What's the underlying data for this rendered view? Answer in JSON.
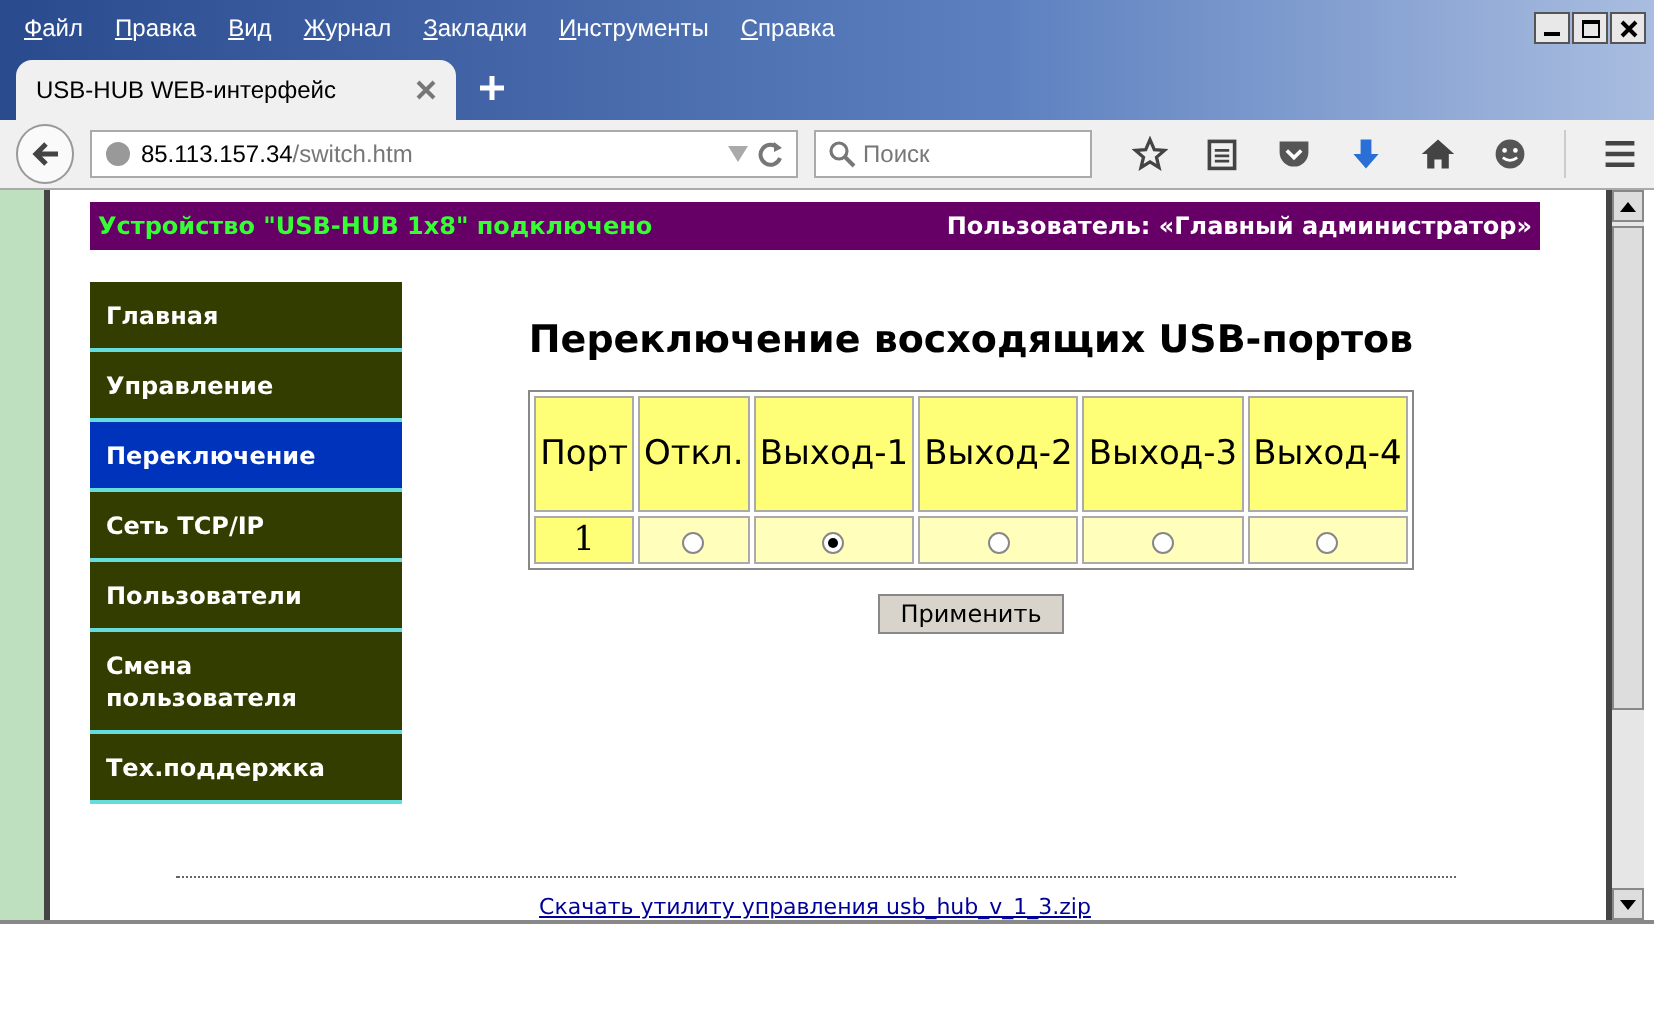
{
  "menu": [
    "Файл",
    "Правка",
    "Вид",
    "Журнал",
    "Закладки",
    "Инструменты",
    "Справка"
  ],
  "tabs": [
    {
      "label": "USB-HUB WEB-интерфейс",
      "selected": true
    }
  ],
  "address": {
    "host": "85.113.157.34",
    "path": "/switch.htm"
  },
  "search": {
    "placeholder": "Поиск"
  },
  "header": {
    "device": "Устройство \"USB-HUB 1x8\" подключено",
    "user": "Пользователь: «Главный администратор»"
  },
  "sidebar": {
    "items": [
      {
        "label": "Главная",
        "selected": false
      },
      {
        "label": "Управление",
        "selected": false
      },
      {
        "label": "Переключение",
        "selected": true
      },
      {
        "label": "Сеть TCP/IP",
        "selected": false
      },
      {
        "label": "Пользователи",
        "selected": false
      },
      {
        "label": "Смена пользователя",
        "selected": false
      },
      {
        "label": "Тех.поддержка",
        "selected": false
      }
    ]
  },
  "heading": "Переключение восходящих USB-портов",
  "table": {
    "columns": [
      "Порт",
      "Откл.",
      "Выход-1",
      "Выход-2",
      "Выход-3",
      "Выход-4"
    ],
    "rows": [
      {
        "port": "1",
        "options": [
          {
            "selected": false
          },
          {
            "selected": true
          },
          {
            "selected": false
          },
          {
            "selected": false
          },
          {
            "selected": false
          }
        ]
      }
    ]
  },
  "apply_button": "Применить",
  "footer_link": "Скачать утилиту управления usb_hub_v_1_3.zip"
}
